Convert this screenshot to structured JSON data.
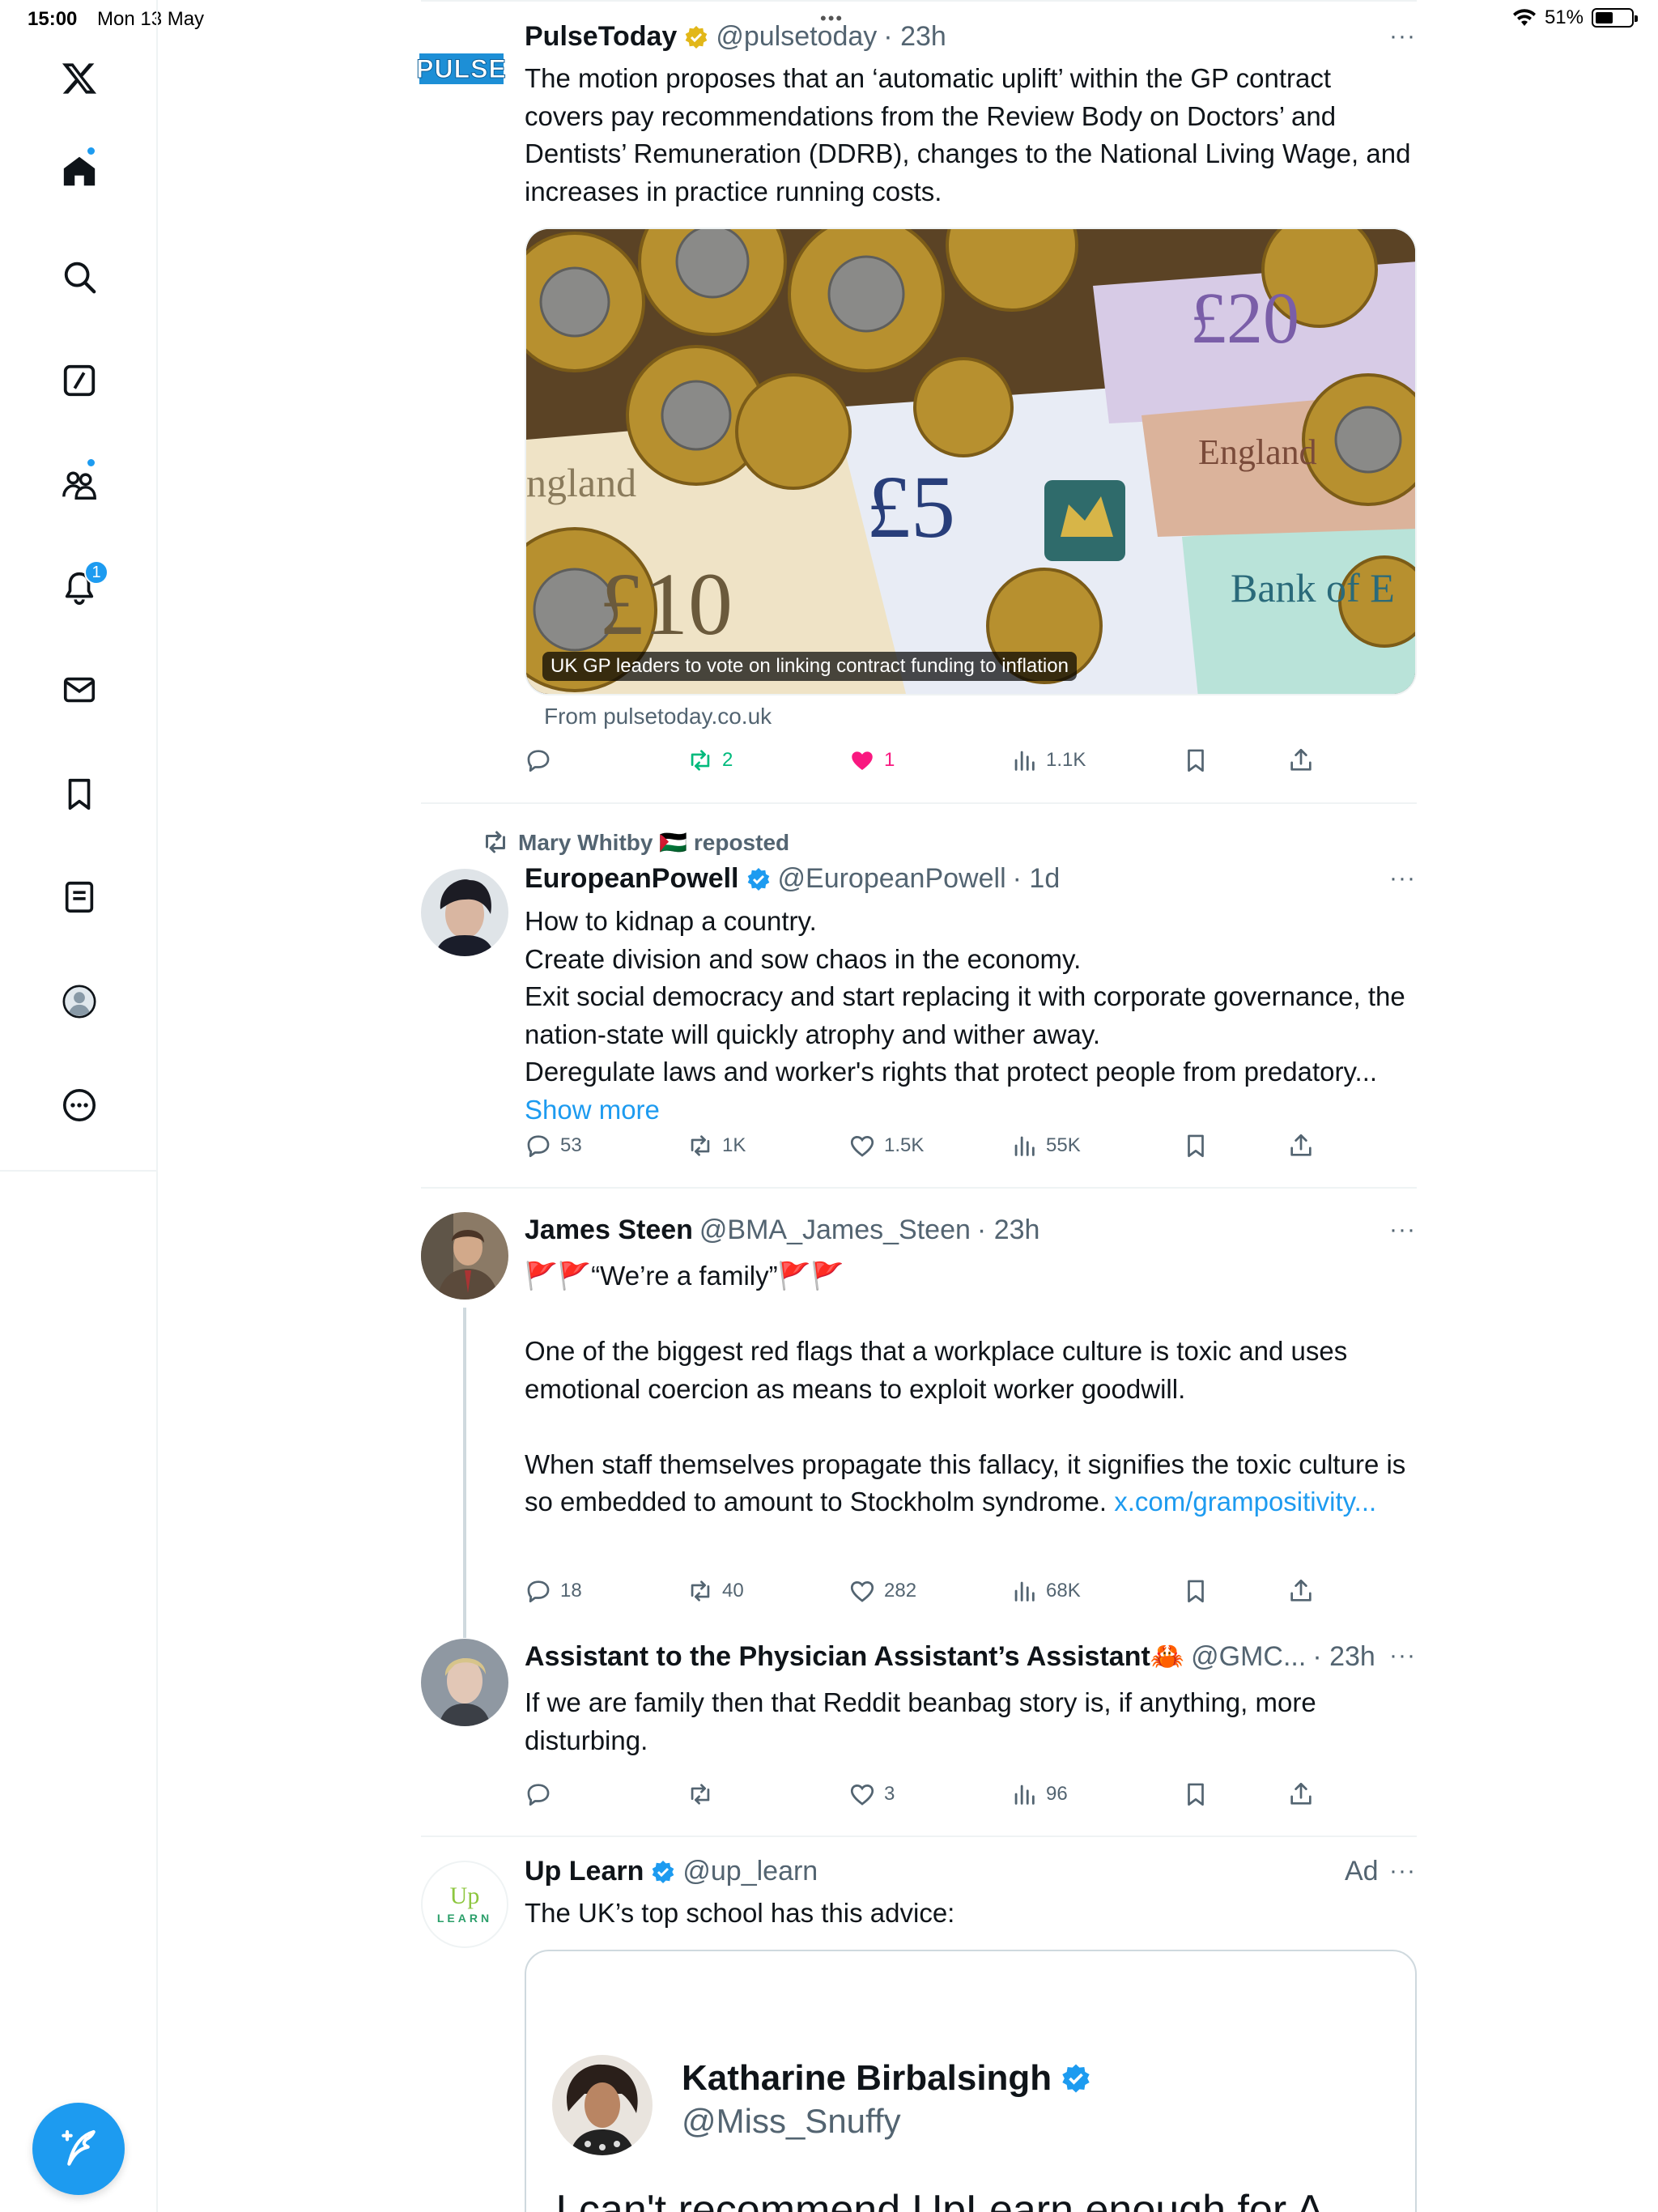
{
  "status": {
    "time": "15:00",
    "date": "Mon 13 May",
    "battery": "51%",
    "battery_level": 0.51
  },
  "sidebar": {
    "items": [
      {
        "name": "x-logo-icon"
      },
      {
        "name": "home-icon"
      },
      {
        "name": "search-icon"
      },
      {
        "name": "grok-icon"
      },
      {
        "name": "communities-icon"
      },
      {
        "name": "notifications-icon",
        "badge": "1"
      },
      {
        "name": "messages-icon"
      },
      {
        "name": "bookmarks-icon"
      },
      {
        "name": "lists-icon"
      },
      {
        "name": "profile-icon"
      },
      {
        "name": "more-icon"
      }
    ]
  },
  "tweets": [
    {
      "name": "PulseToday",
      "handle": "@pulsetoday",
      "time": "· 23h",
      "text": "The motion proposes that an ‘automatic uplift’ within the GP contract covers pay recommendations from the Review Body on Doctors’ and Dentists’ Remuneration (DDRB), changes to the National Living Wage, and increases in practice running costs.",
      "media_caption": "UK GP leaders to vote on linking contract funding to inflation",
      "source": "From pulsetoday.co.uk",
      "replies": "",
      "reposts": "2",
      "likes": "1",
      "views": "1.1K",
      "logo": "PULSE"
    },
    {
      "repost_by": "Mary Whitby 🇵🇸 reposted",
      "name": "EuropeanPowell",
      "handle": "@EuropeanPowell",
      "time": "· 1d",
      "lines": [
        "How to kidnap a country.",
        "Create division and sow chaos in the economy.",
        "Exit social democracy and start replacing it with corporate governance, the nation-state will quickly atrophy and wither away.",
        "Deregulate laws and worker's rights that protect people from predatory..."
      ],
      "show_more": "Show more",
      "replies": "53",
      "reposts": "1K",
      "likes": "1.5K",
      "views": "55K"
    },
    {
      "name": "James Steen",
      "handle": "@BMA_James_Steen",
      "time": "· 23h",
      "line1": "🚩🚩“We’re a family”🚩🚩",
      "para2": "One of the biggest red flags that a workplace culture is toxic and uses emotional coercion as means to exploit worker goodwill.",
      "para3": "When staff themselves propagate this fallacy, it signifies the toxic culture is so embedded to amount to Stockholm syndrome.",
      "link": "x.com/grampositivity...",
      "replies": "18",
      "reposts": "40",
      "likes": "282",
      "views": "68K"
    },
    {
      "name": "Assistant to the Physician Assistant’s Assistant🦀",
      "handle": "@GMC...",
      "time": "· 23h",
      "text": "If we are family then that Reddit beanbag story is, if anything, more disturbing.",
      "replies": "",
      "reposts": "",
      "likes": "3",
      "views": "96"
    },
    {
      "name": "Up Learn",
      "handle": "@up_learn",
      "ad_label": "Ad",
      "text": "The UK’s top school has this advice:",
      "logo_top": "Up",
      "logo_bottom": "LEARN",
      "card": {
        "name": "Katharine Birbalsingh",
        "handle": "@Miss_Snuffy",
        "quote_underlined": "can't recommend UpLearn",
        "quote_pre": "I ",
        "quote_post": " enough for A"
      }
    }
  ],
  "colors": {
    "accent": "#1d9bf0",
    "repost_green": "#00ba7c",
    "like_pink": "#f91880",
    "secondary": "#536471"
  }
}
